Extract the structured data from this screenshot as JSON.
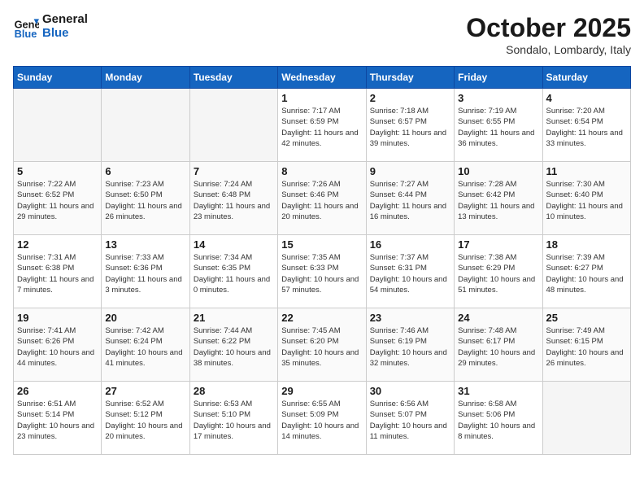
{
  "header": {
    "logo_line1": "General",
    "logo_line2": "Blue",
    "month_title": "October 2025",
    "location": "Sondalo, Lombardy, Italy"
  },
  "weekdays": [
    "Sunday",
    "Monday",
    "Tuesday",
    "Wednesday",
    "Thursday",
    "Friday",
    "Saturday"
  ],
  "weeks": [
    [
      {
        "day": "",
        "empty": true
      },
      {
        "day": "",
        "empty": true
      },
      {
        "day": "",
        "empty": true
      },
      {
        "day": "1",
        "sunrise": "7:17 AM",
        "sunset": "6:59 PM",
        "daylight": "11 hours and 42 minutes."
      },
      {
        "day": "2",
        "sunrise": "7:18 AM",
        "sunset": "6:57 PM",
        "daylight": "11 hours and 39 minutes."
      },
      {
        "day": "3",
        "sunrise": "7:19 AM",
        "sunset": "6:55 PM",
        "daylight": "11 hours and 36 minutes."
      },
      {
        "day": "4",
        "sunrise": "7:20 AM",
        "sunset": "6:54 PM",
        "daylight": "11 hours and 33 minutes."
      }
    ],
    [
      {
        "day": "5",
        "sunrise": "7:22 AM",
        "sunset": "6:52 PM",
        "daylight": "11 hours and 29 minutes."
      },
      {
        "day": "6",
        "sunrise": "7:23 AM",
        "sunset": "6:50 PM",
        "daylight": "11 hours and 26 minutes."
      },
      {
        "day": "7",
        "sunrise": "7:24 AM",
        "sunset": "6:48 PM",
        "daylight": "11 hours and 23 minutes."
      },
      {
        "day": "8",
        "sunrise": "7:26 AM",
        "sunset": "6:46 PM",
        "daylight": "11 hours and 20 minutes."
      },
      {
        "day": "9",
        "sunrise": "7:27 AM",
        "sunset": "6:44 PM",
        "daylight": "11 hours and 16 minutes."
      },
      {
        "day": "10",
        "sunrise": "7:28 AM",
        "sunset": "6:42 PM",
        "daylight": "11 hours and 13 minutes."
      },
      {
        "day": "11",
        "sunrise": "7:30 AM",
        "sunset": "6:40 PM",
        "daylight": "11 hours and 10 minutes."
      }
    ],
    [
      {
        "day": "12",
        "sunrise": "7:31 AM",
        "sunset": "6:38 PM",
        "daylight": "11 hours and 7 minutes."
      },
      {
        "day": "13",
        "sunrise": "7:33 AM",
        "sunset": "6:36 PM",
        "daylight": "11 hours and 3 minutes."
      },
      {
        "day": "14",
        "sunrise": "7:34 AM",
        "sunset": "6:35 PM",
        "daylight": "11 hours and 0 minutes."
      },
      {
        "day": "15",
        "sunrise": "7:35 AM",
        "sunset": "6:33 PM",
        "daylight": "10 hours and 57 minutes."
      },
      {
        "day": "16",
        "sunrise": "7:37 AM",
        "sunset": "6:31 PM",
        "daylight": "10 hours and 54 minutes."
      },
      {
        "day": "17",
        "sunrise": "7:38 AM",
        "sunset": "6:29 PM",
        "daylight": "10 hours and 51 minutes."
      },
      {
        "day": "18",
        "sunrise": "7:39 AM",
        "sunset": "6:27 PM",
        "daylight": "10 hours and 48 minutes."
      }
    ],
    [
      {
        "day": "19",
        "sunrise": "7:41 AM",
        "sunset": "6:26 PM",
        "daylight": "10 hours and 44 minutes."
      },
      {
        "day": "20",
        "sunrise": "7:42 AM",
        "sunset": "6:24 PM",
        "daylight": "10 hours and 41 minutes."
      },
      {
        "day": "21",
        "sunrise": "7:44 AM",
        "sunset": "6:22 PM",
        "daylight": "10 hours and 38 minutes."
      },
      {
        "day": "22",
        "sunrise": "7:45 AM",
        "sunset": "6:20 PM",
        "daylight": "10 hours and 35 minutes."
      },
      {
        "day": "23",
        "sunrise": "7:46 AM",
        "sunset": "6:19 PM",
        "daylight": "10 hours and 32 minutes."
      },
      {
        "day": "24",
        "sunrise": "7:48 AM",
        "sunset": "6:17 PM",
        "daylight": "10 hours and 29 minutes."
      },
      {
        "day": "25",
        "sunrise": "7:49 AM",
        "sunset": "6:15 PM",
        "daylight": "10 hours and 26 minutes."
      }
    ],
    [
      {
        "day": "26",
        "sunrise": "6:51 AM",
        "sunset": "5:14 PM",
        "daylight": "10 hours and 23 minutes."
      },
      {
        "day": "27",
        "sunrise": "6:52 AM",
        "sunset": "5:12 PM",
        "daylight": "10 hours and 20 minutes."
      },
      {
        "day": "28",
        "sunrise": "6:53 AM",
        "sunset": "5:10 PM",
        "daylight": "10 hours and 17 minutes."
      },
      {
        "day": "29",
        "sunrise": "6:55 AM",
        "sunset": "5:09 PM",
        "daylight": "10 hours and 14 minutes."
      },
      {
        "day": "30",
        "sunrise": "6:56 AM",
        "sunset": "5:07 PM",
        "daylight": "10 hours and 11 minutes."
      },
      {
        "day": "31",
        "sunrise": "6:58 AM",
        "sunset": "5:06 PM",
        "daylight": "10 hours and 8 minutes."
      },
      {
        "day": "",
        "empty": true
      }
    ]
  ]
}
